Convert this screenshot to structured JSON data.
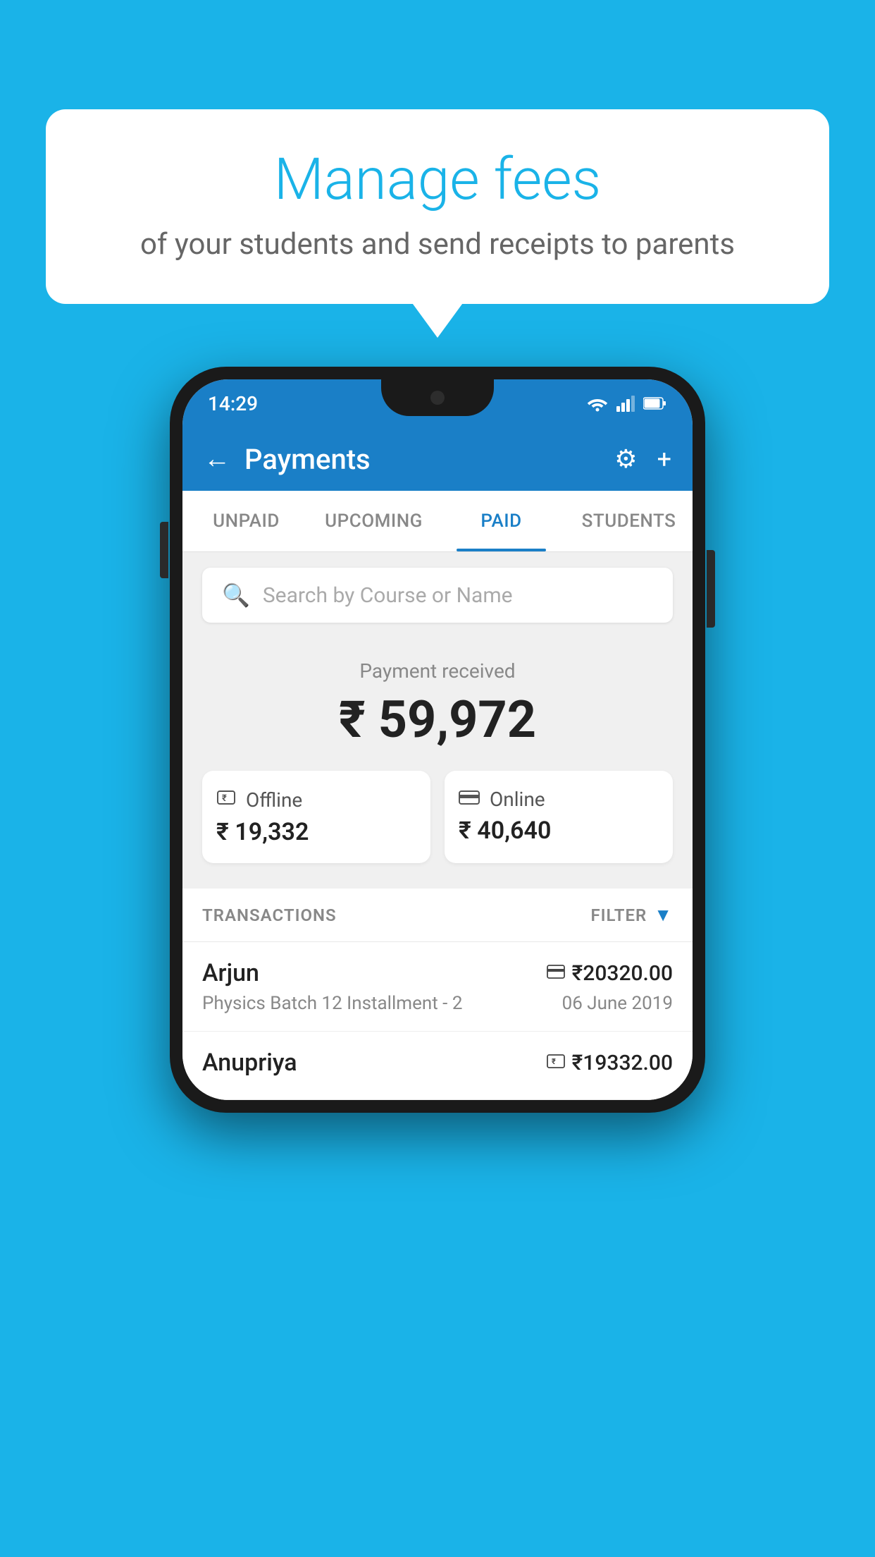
{
  "background_color": "#1ab3e8",
  "speech_bubble": {
    "title": "Manage fees",
    "subtitle": "of your students and send receipts to parents"
  },
  "status_bar": {
    "time": "14:29"
  },
  "app_header": {
    "title": "Payments",
    "back_label": "←",
    "settings_label": "⚙",
    "add_label": "+"
  },
  "tabs": [
    {
      "label": "UNPAID",
      "active": false
    },
    {
      "label": "UPCOMING",
      "active": false
    },
    {
      "label": "PAID",
      "active": true
    },
    {
      "label": "STUDENTS",
      "active": false
    }
  ],
  "search": {
    "placeholder": "Search by Course or Name"
  },
  "payment_section": {
    "label": "Payment received",
    "total_amount": "₹ 59,972",
    "offline": {
      "type": "Offline",
      "amount": "₹ 19,332"
    },
    "online": {
      "type": "Online",
      "amount": "₹ 40,640"
    }
  },
  "transactions_section": {
    "label": "TRANSACTIONS",
    "filter_label": "FILTER"
  },
  "transactions": [
    {
      "name": "Arjun",
      "amount": "₹20320.00",
      "course": "Physics Batch 12 Installment - 2",
      "date": "06 June 2019",
      "payment_type": "online"
    },
    {
      "name": "Anupriya",
      "amount": "₹19332.00",
      "course": "",
      "date": "",
      "payment_type": "offline"
    }
  ]
}
